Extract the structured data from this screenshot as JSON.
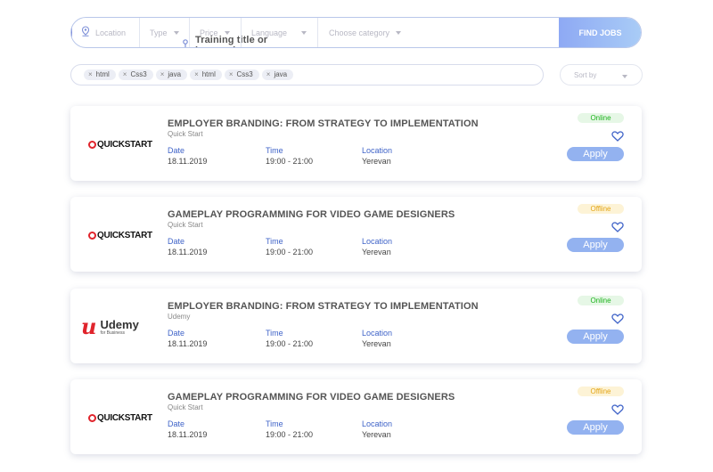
{
  "search": {
    "title_placeholder": "Training title or keywords",
    "location_placeholder": "Location",
    "type_label": "Type",
    "price_label": "Price",
    "language_label": "Language",
    "category_label": "Choose category",
    "find_button": "FIND JOBS"
  },
  "tags": [
    "html",
    "Css3",
    "java",
    "html",
    "Css3",
    "java"
  ],
  "sort_label": "Sort by",
  "colors": {
    "accent": "#3f63c8",
    "apply_button": "#93b2f0",
    "online": "#1db31d",
    "offline": "#e3a515"
  },
  "labels": {
    "date": "Date",
    "time": "Time",
    "location": "Location",
    "apply": "Apply"
  },
  "cards": [
    {
      "logo": "QUICKSTART",
      "title": "EMPLOYER BRANDING: FROM STRATEGY TO IMPLEMENTATION",
      "company": "Quick Start",
      "date": "18.11.2019",
      "time": "19:00 - 21:00",
      "location": "Yerevan",
      "status": "Online"
    },
    {
      "logo": "QUICKSTART",
      "title": "GAMEPLAY PROGRAMMING FOR VIDEO GAME DESIGNERS",
      "company": "Quick Start",
      "date": "18.11.2019",
      "time": "19:00 - 21:00",
      "location": "Yerevan",
      "status": "Offline"
    },
    {
      "logo": "Udemy",
      "logo_sub": "for Business",
      "title": "EMPLOYER BRANDING: FROM STRATEGY TO IMPLEMENTATION",
      "company": "Udemy",
      "date": "18.11.2019",
      "time": "19:00 - 21:00",
      "location": "Yerevan",
      "status": "Online"
    },
    {
      "logo": "QUICKSTART",
      "title": "GAMEPLAY PROGRAMMING FOR VIDEO GAME DESIGNERS",
      "company": "Quick Start",
      "date": "18.11.2019",
      "time": "19:00 - 21:00",
      "location": "Yerevan",
      "status": "Offline"
    }
  ]
}
